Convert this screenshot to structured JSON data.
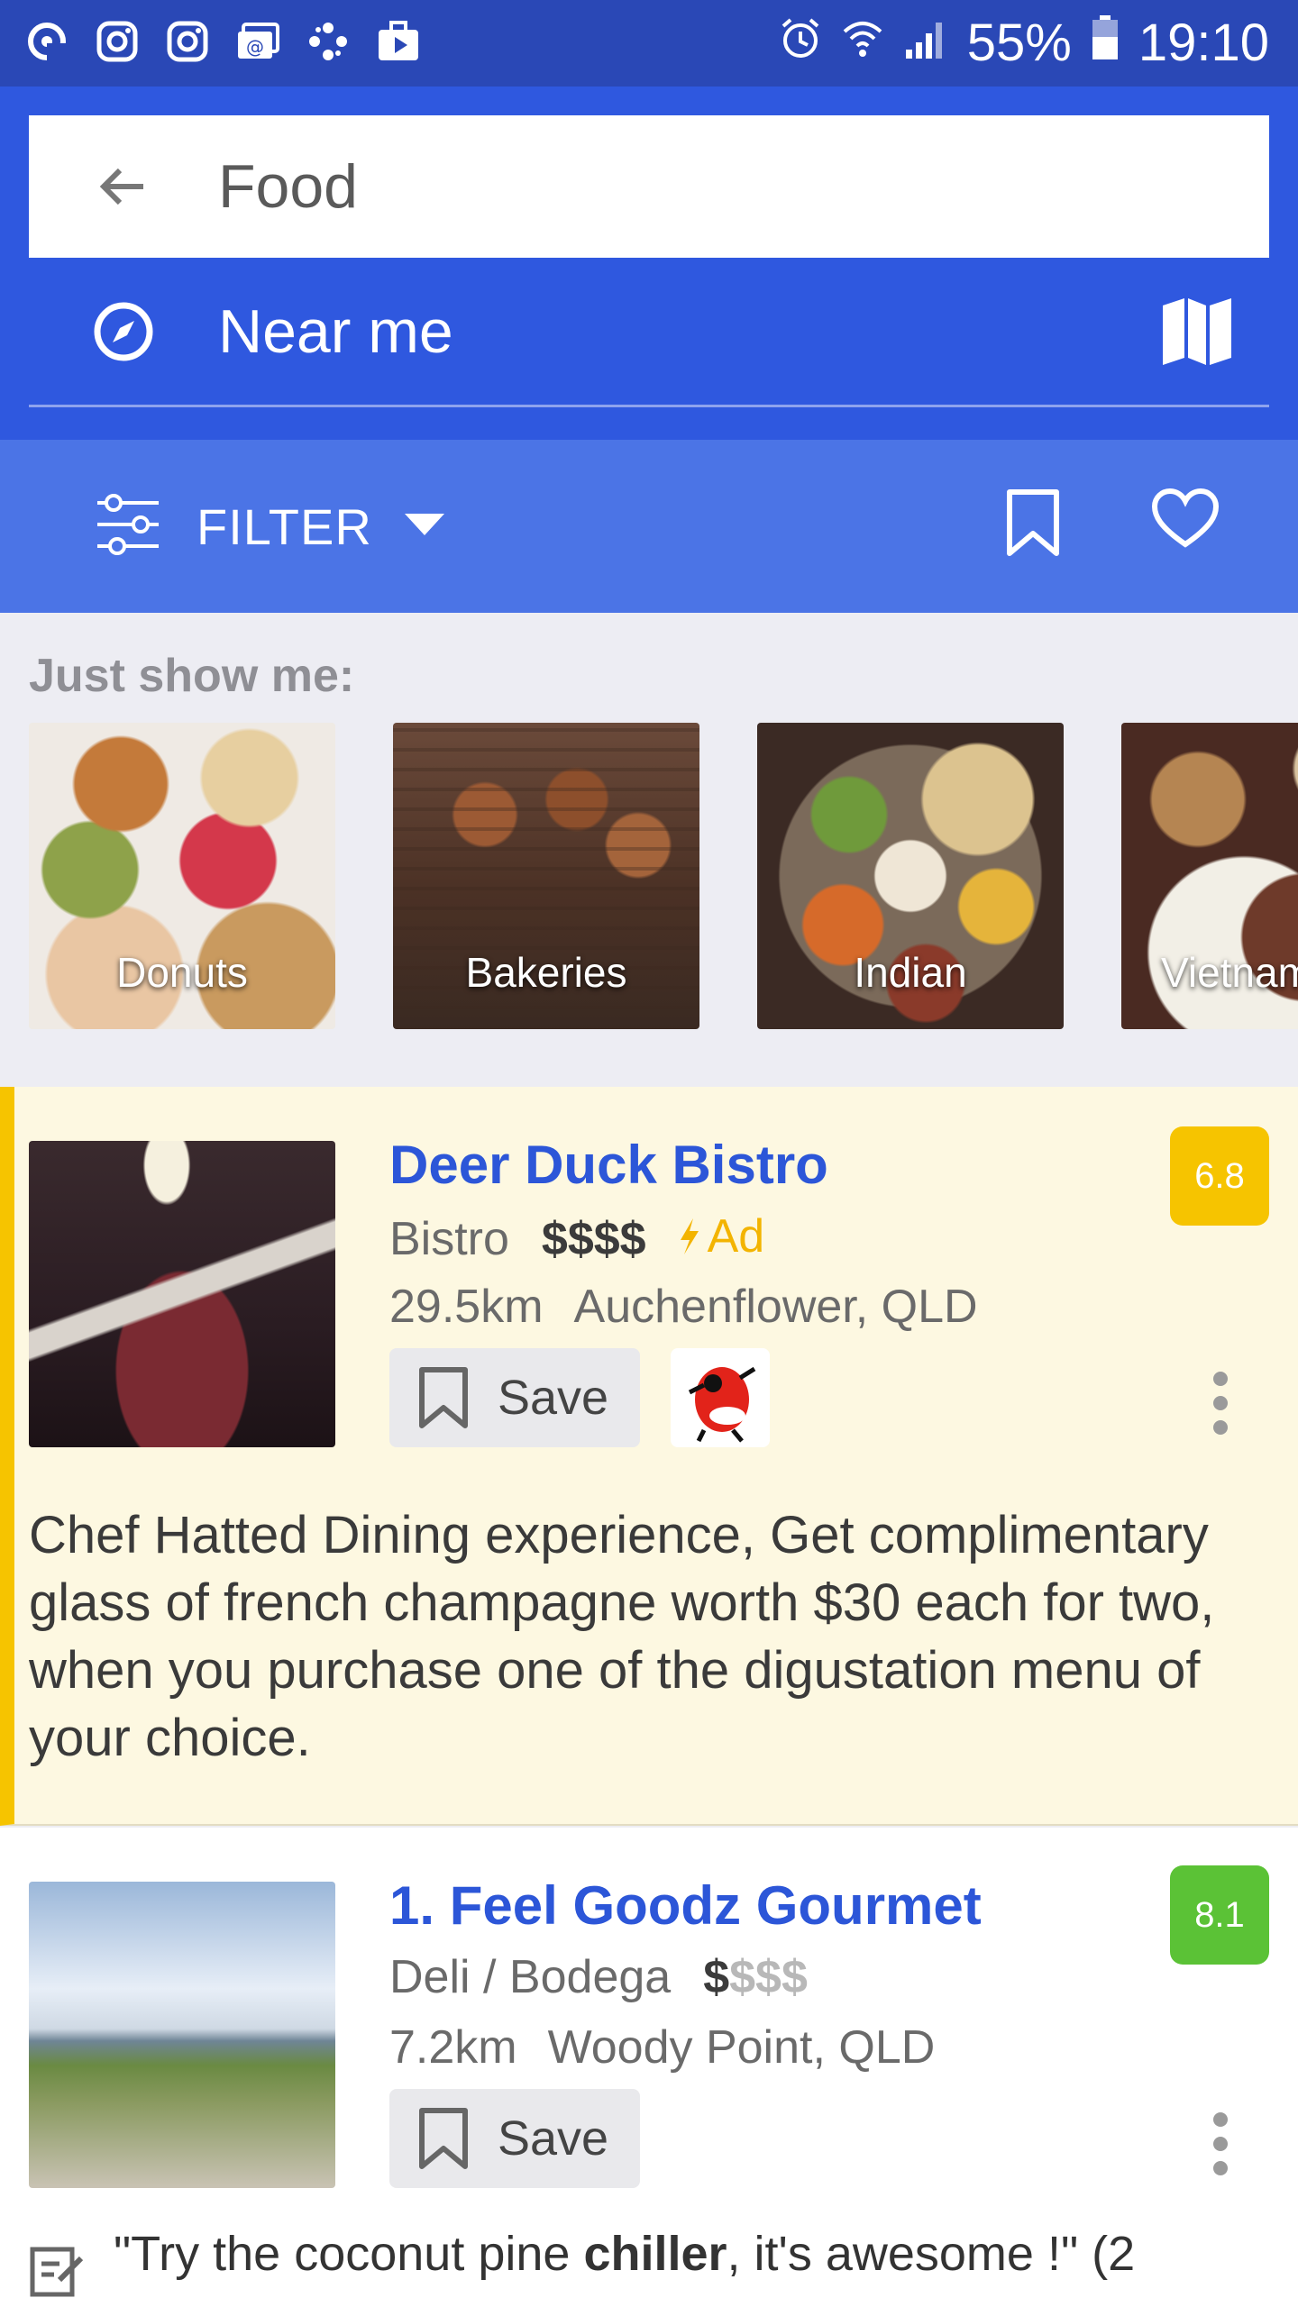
{
  "status_bar": {
    "left_icons": [
      "vpn-key-icon",
      "instagram-icon",
      "instagram-icon",
      "email-icon",
      "app-icon",
      "briefcase-icon"
    ],
    "battery_percent": "55%",
    "time": "19:10"
  },
  "search": {
    "query": "Food"
  },
  "location": {
    "label": "Near me"
  },
  "filter": {
    "label": "FILTER"
  },
  "categories": {
    "heading": "Just show me:",
    "items": [
      {
        "label": "Donuts"
      },
      {
        "label": "Bakeries"
      },
      {
        "label": "Indian"
      },
      {
        "label": "Vietnamese"
      }
    ]
  },
  "listings": [
    {
      "name": "Deer Duck Bistro",
      "category": "Bistro",
      "price": "$$$$",
      "price_level": 4,
      "ad_label": "Ad",
      "distance": "29.5km",
      "suburb": "Auchenflower, QLD",
      "score": "6.8",
      "score_color": "#f6c400",
      "save_label": "Save",
      "description": "Chef Hatted Dining experience, Get complimentary glass of french champagne worth $30 each for two, when you purchase one of the digustation menu of your choice."
    },
    {
      "name": "1. Feel Goodz Gourmet",
      "category": "Deli / Bodega",
      "price_active": "$",
      "price_inactive": "$$$",
      "price_level": 1,
      "distance": "7.2km",
      "suburb": "Woody Point, QLD",
      "score": "8.1",
      "score_color": "#5bc236",
      "save_label": "Save",
      "tip_pre": "\"Try the coconut pine ",
      "tip_bold": "chiller",
      "tip_post": ", it's awesome !\" (2"
    }
  ]
}
